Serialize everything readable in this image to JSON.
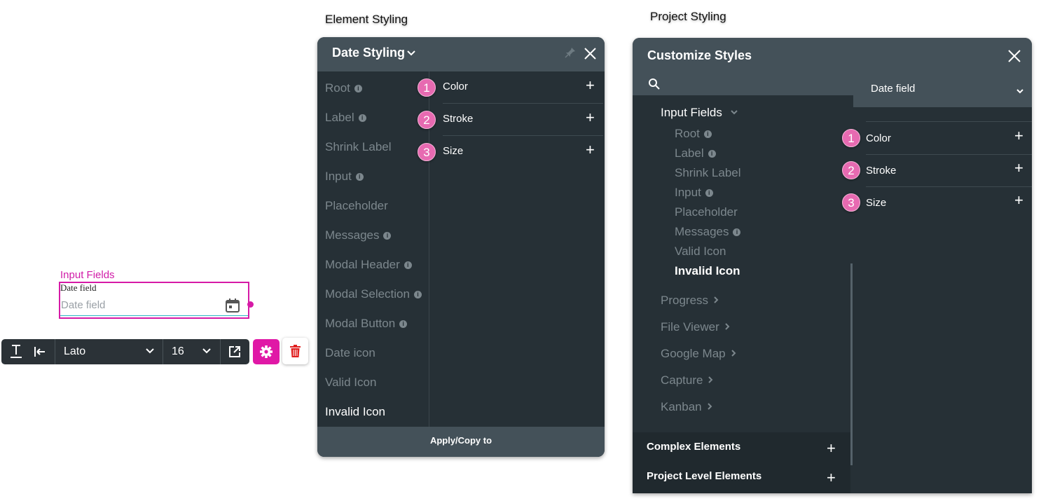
{
  "captions": {
    "element_styling": "Element Styling",
    "project_styling": "Project Styling"
  },
  "widget": {
    "title": "Input Fields",
    "label": "Date field",
    "placeholder": "Date field"
  },
  "toolbar": {
    "font": "Lato",
    "size": "16"
  },
  "date_panel": {
    "title": "Date Styling",
    "items": [
      {
        "label": "Root",
        "info": true
      },
      {
        "label": "Label",
        "info": true
      },
      {
        "label": "Shrink Label",
        "info": false
      },
      {
        "label": "Input",
        "info": true
      },
      {
        "label": "Placeholder",
        "info": false
      },
      {
        "label": "Messages",
        "info": true
      },
      {
        "label": "Modal Header",
        "info": true
      },
      {
        "label": "Modal Selection",
        "info": true
      },
      {
        "label": "Modal Button",
        "info": true
      },
      {
        "label": "Date icon",
        "info": false
      },
      {
        "label": "Valid Icon",
        "info": false
      },
      {
        "label": "Invalid Icon",
        "info": false
      }
    ],
    "properties": [
      {
        "badge": "1",
        "label": "Color"
      },
      {
        "badge": "2",
        "label": "Stroke"
      },
      {
        "badge": "3",
        "label": "Size"
      }
    ],
    "footer": "Apply/Copy to"
  },
  "customize_panel": {
    "title": "Customize Styles",
    "select_value": "Date field",
    "group_label": "Input Fields",
    "children": [
      {
        "label": "Root",
        "info": true
      },
      {
        "label": "Label",
        "info": true
      },
      {
        "label": "Shrink Label",
        "info": false
      },
      {
        "label": "Input",
        "info": true
      },
      {
        "label": "Placeholder",
        "info": false
      },
      {
        "label": "Messages",
        "info": true
      },
      {
        "label": "Valid Icon",
        "info": false
      },
      {
        "label": "Invalid Icon",
        "info": false
      }
    ],
    "other_groups": [
      "Progress",
      "File Viewer",
      "Google Map",
      "Capture",
      "Kanban"
    ],
    "bottom_sections": [
      "Complex Elements",
      "Project Level Elements"
    ],
    "properties": [
      {
        "badge": "1",
        "label": "Color"
      },
      {
        "badge": "2",
        "label": "Stroke"
      },
      {
        "badge": "3",
        "label": "Size"
      }
    ]
  },
  "colors": {
    "accent": "#e018a6",
    "panel_bg": "#263036",
    "panel_header": "#445159",
    "badge": "#e76ab1"
  },
  "icons": [
    "calendar-icon",
    "text-color-icon",
    "indent-icon",
    "chevron-down-icon",
    "external-link-icon",
    "gear-icon",
    "trash-icon",
    "pin-icon",
    "close-icon",
    "search-icon",
    "plus-icon",
    "chevron-right-icon",
    "info-icon"
  ]
}
